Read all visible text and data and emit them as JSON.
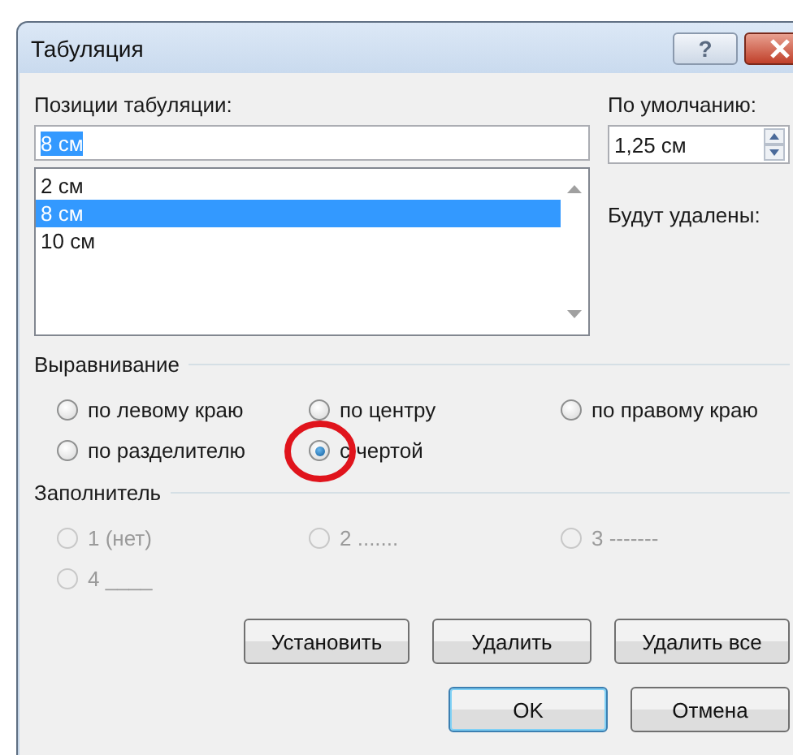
{
  "window": {
    "title": "Табуляция",
    "help": "?"
  },
  "tab_positions": {
    "label": "Позиции табуляции:",
    "value": "8 см",
    "value_selected": true,
    "items": [
      {
        "label": "2 см",
        "selected": false
      },
      {
        "label": "8 см",
        "selected": true
      },
      {
        "label": "10 см",
        "selected": false
      }
    ]
  },
  "default_stops": {
    "label": "По умолчанию:",
    "value": "1,25 см"
  },
  "to_be_removed": {
    "label": "Будут удалены:"
  },
  "alignment": {
    "title": "Выравнивание",
    "options": [
      {
        "label": "по левому краю",
        "selected": false,
        "disabled": false,
        "circled": false
      },
      {
        "label": "по центру",
        "selected": false,
        "disabled": false,
        "circled": false
      },
      {
        "label": "по правому краю",
        "selected": false,
        "disabled": false,
        "circled": false
      },
      {
        "label": "по разделителю",
        "selected": false,
        "disabled": false,
        "circled": false
      },
      {
        "label": "с чертой",
        "selected": true,
        "disabled": false,
        "circled": true
      }
    ]
  },
  "leader": {
    "title": "Заполнитель",
    "options": [
      {
        "label": "1 (нет)",
        "selected": false,
        "disabled": true,
        "circled": false
      },
      {
        "label": "2 .......",
        "selected": false,
        "disabled": true,
        "circled": false
      },
      {
        "label": "3 -------",
        "selected": false,
        "disabled": true,
        "circled": false
      },
      {
        "label": "4 ____",
        "selected": false,
        "disabled": true,
        "circled": false
      }
    ]
  },
  "actions": [
    {
      "label": "Установить"
    },
    {
      "label": "Удалить"
    },
    {
      "label": "Удалить все"
    }
  ],
  "dialog_buttons": [
    {
      "label": "OK",
      "default": true
    },
    {
      "label": "Отмена",
      "default": false
    }
  ]
}
